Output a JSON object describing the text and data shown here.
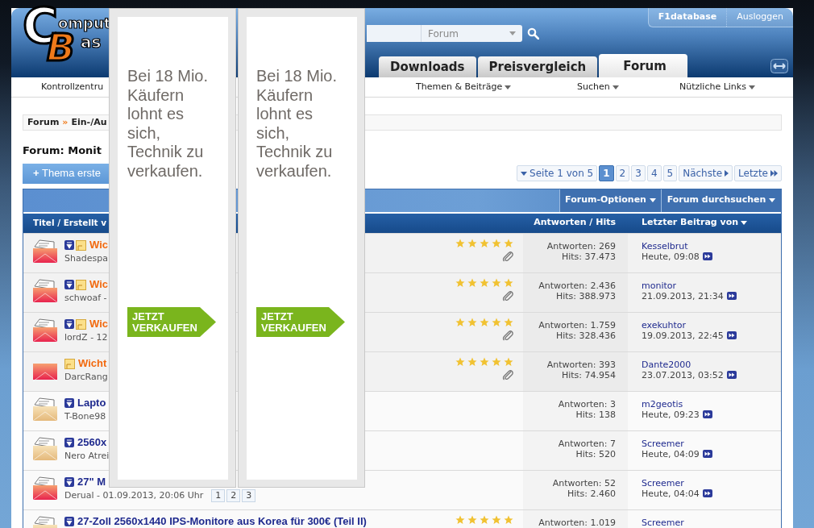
{
  "logo": {
    "initial_1": "C",
    "rest_1": "omput",
    "initial_2": "B",
    "rest_2": "as"
  },
  "user_bar": {
    "username": "F1database",
    "logout": "Ausloggen"
  },
  "search": {
    "scope": "Forum"
  },
  "tabs": [
    {
      "label": "Downloads",
      "selected": false
    },
    {
      "label": "Preisvergleich",
      "selected": false
    },
    {
      "label": "Forum",
      "selected": true
    }
  ],
  "subnav": [
    {
      "label": "Kontrollzentru",
      "dropdown": false
    },
    {
      "label": "Themen & Beiträge",
      "dropdown": true
    },
    {
      "label": "Suchen",
      "dropdown": true
    },
    {
      "label": "Nützliche Links",
      "dropdown": true
    }
  ],
  "breadcrumb": {
    "items": [
      "Forum",
      "Ein-/Au"
    ],
    "separator": "»"
  },
  "forum_title": "Forum: Monit",
  "new_thread_button": {
    "icon": "+",
    "label": "Thema erste"
  },
  "pagination": {
    "summary": "Seite 1 von 5",
    "pages": [
      {
        "label": "1",
        "selected": true
      },
      {
        "label": "2",
        "selected": false
      },
      {
        "label": "3",
        "selected": false
      },
      {
        "label": "4",
        "selected": false
      },
      {
        "label": "5",
        "selected": false
      }
    ],
    "next": "Nächste",
    "last": "Letzte"
  },
  "table": {
    "toolbar": [
      "Forum-Optionen",
      "Forum durchsuchen"
    ],
    "columns": [
      {
        "label": "Titel / Erstellt v",
        "dropdown": false
      },
      {
        "label": "Antworten / Hits",
        "dropdown": false
      },
      {
        "label": "Letzter Beitrag von",
        "dropdown": true
      }
    ],
    "rows": [
      {
        "sticky": true,
        "kind": "hot",
        "new_posts": true,
        "title": "Wic",
        "starter": "Shadespa",
        "stars": 5,
        "attachment": true,
        "replies": "Antworten: 269",
        "hits": "Hits: 37.473",
        "last_poster": "Kesselbrut",
        "last_time": "Heute, 09:08"
      },
      {
        "sticky": true,
        "kind": "hot",
        "new_posts": true,
        "title": "Wic",
        "starter": "schwoaf -",
        "stars": 5,
        "attachment": true,
        "replies": "Antworten: 2.436",
        "hits": "Hits: 388.973",
        "last_poster": "monitor",
        "last_time": "21.09.2013, 21:34"
      },
      {
        "sticky": true,
        "kind": "hot",
        "new_posts": true,
        "title": "Wic",
        "starter": "lordZ - 12",
        "stars": 5,
        "attachment": true,
        "replies": "Antworten: 1.759",
        "hits": "Hits: 328.436",
        "last_poster": "exekuhtor",
        "last_time": "19.09.2013, 22:45"
      },
      {
        "sticky": true,
        "kind": "hot-closed",
        "new_posts": false,
        "title": "Wicht",
        "starter": "DarcRang",
        "stars": 5,
        "attachment": true,
        "replies": "Antworten: 393",
        "hits": "Hits: 74.954",
        "last_poster": "Dante2000",
        "last_time": "23.07.2013, 03:52"
      },
      {
        "sticky": false,
        "kind": "normal",
        "new_posts": true,
        "title": "Lapto",
        "starter": "T-Bone98",
        "attachment": false,
        "replies": "Antworten: 3",
        "hits": "Hits: 138",
        "last_poster": "m2geotis",
        "last_time": "Heute, 09:23"
      },
      {
        "sticky": false,
        "kind": "normal",
        "new_posts": true,
        "title": "2560x",
        "starter": "Nero Atrei",
        "attachment": false,
        "replies": "Antworten: 7",
        "hits": "Hits: 520",
        "last_poster": "Screemer",
        "last_time": "Heute, 04:09"
      },
      {
        "sticky": false,
        "kind": "hot",
        "new_posts": true,
        "title": "27\" M",
        "starter": "Derual - 01.09.2013, 20:06 Uhr",
        "pages": [
          "1",
          "2",
          "3"
        ],
        "attachment": false,
        "replies": "Antworten: 52",
        "hits": "Hits: 2.460",
        "last_poster": "Screemer",
        "last_time": "Heute, 04:04"
      },
      {
        "sticky": false,
        "kind": "normal",
        "new_posts": true,
        "title": "27-Zoll 2560x1440 IPS-Monitore aus Korea für 300€ (Teil II)",
        "stars": 5,
        "attachment": false,
        "replies": "Antworten: 1.019",
        "last_poster": "Screemer"
      }
    ]
  },
  "ads": [
    {
      "text_lines": [
        "Bei 18 Mio.",
        "Käufern",
        "lohnt es",
        "sich,",
        "Technik zu",
        "verkaufen."
      ],
      "cta_lines": [
        "JETZT",
        "VERKAUFEN"
      ]
    },
    {
      "text_lines": [
        "Bei 18 Mio.",
        "Käufern",
        "lohnt es",
        "sich,",
        "Technik zu",
        "verkaufen."
      ],
      "cta_lines": [
        "JETZT",
        "VERKAUFEN"
      ]
    }
  ]
}
